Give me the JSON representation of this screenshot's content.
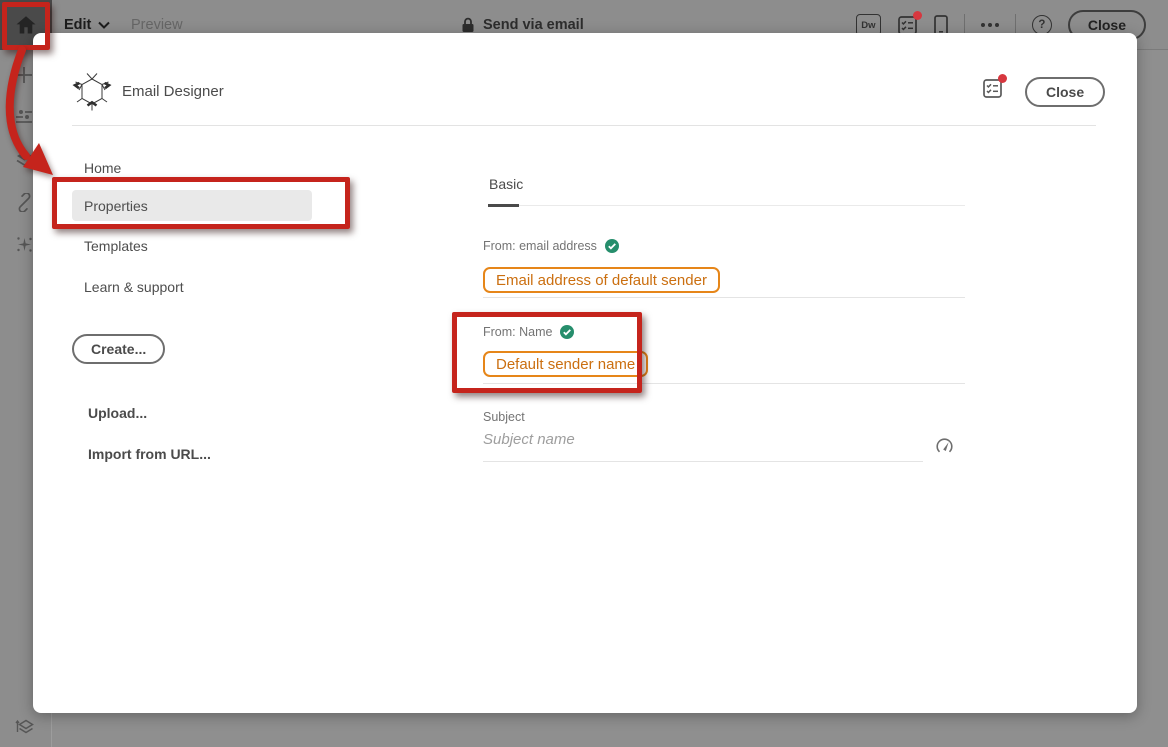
{
  "topbar": {
    "edit": "Edit",
    "preview": "Preview",
    "send_via_email": "Send via email",
    "dw_badge": "Dw",
    "help_glyph": "?",
    "close_label": "Close"
  },
  "modal": {
    "title": "Email Designer",
    "close_label": "Close",
    "nav": {
      "home": "Home",
      "properties": "Properties",
      "templates": "Templates",
      "learn_support": "Learn & support",
      "create": "Create...",
      "upload": "Upload...",
      "import_url": "Import from URL..."
    },
    "tabs": {
      "basic": "Basic"
    },
    "fields": {
      "from_email": {
        "label": "From: email address",
        "value": "Email address of default sender"
      },
      "from_name": {
        "label": "From: Name",
        "value": "Default sender name"
      },
      "subject": {
        "label": "Subject",
        "placeholder": "Subject name",
        "value": ""
      }
    }
  },
  "colors": {
    "annotation_red": "#c5241c",
    "chip_border_orange": "#e68619",
    "chip_text_orange": "#cb6f10",
    "valid_green": "#268e6c",
    "notification_red": "#d7373f",
    "dim_background": "#8f8f8f"
  }
}
